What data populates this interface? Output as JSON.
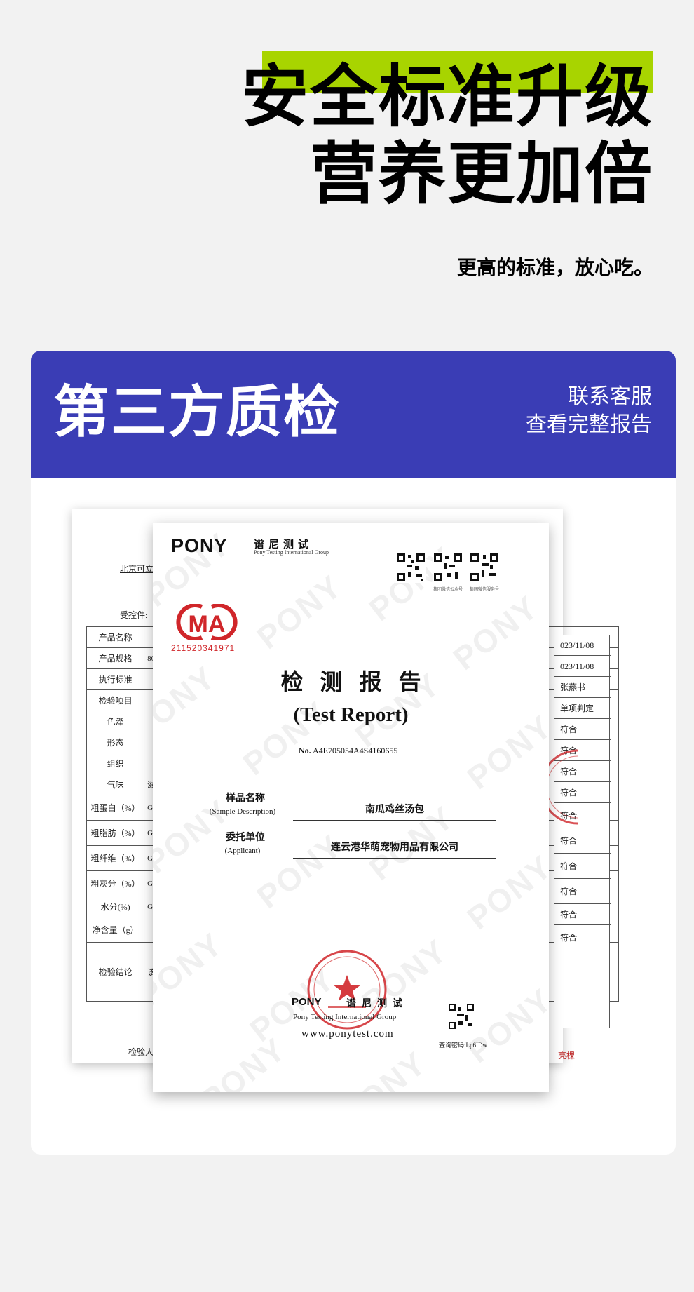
{
  "hero": {
    "line1": "安全标准升级",
    "line2": "营养更加倍",
    "subtitle": "更高的标准，放心吃。",
    "accent_color": "#a8d400"
  },
  "card": {
    "title": "第三方质检",
    "contact_line1": "联系客服",
    "contact_line2": "查看完整报告",
    "header_color": "#3a3db5"
  },
  "back_report": {
    "client": "北京可立",
    "ref_label": "受控件:",
    "rows": [
      {
        "label": "产品名称",
        "mid": "",
        "val": "023/11/08"
      },
      {
        "label": "产品规格",
        "mid": "80",
        "val": "023/11/08"
      },
      {
        "label": "执行标准",
        "mid": "",
        "val": "张燕书"
      },
      {
        "label": "检验项目",
        "mid": "",
        "val": "单项判定"
      },
      {
        "label": "色泽",
        "mid": "",
        "val": "符合"
      },
      {
        "label": "形态",
        "mid": "",
        "val": "符合"
      },
      {
        "label": "组织",
        "mid": "",
        "val": "符合"
      },
      {
        "label": "气味",
        "mid": "滋",
        "val": "符合"
      },
      {
        "label": "粗蛋白（%）",
        "mid": "Gl",
        "val": "符合"
      },
      {
        "label": "粗脂肪（%）",
        "mid": "Gl",
        "val": "符合"
      },
      {
        "label": "粗纤维（%）",
        "mid": "Gl",
        "val": "符合"
      },
      {
        "label": "粗灰分（%）",
        "mid": "Gl",
        "val": "符合"
      },
      {
        "label": "水分(%)",
        "mid": "Gl",
        "val": "符合"
      },
      {
        "label": "净含量（g）",
        "mid": "",
        "val": "符合"
      },
      {
        "label": "检验结论",
        "mid": "该产",
        "val": ""
      }
    ],
    "inspector": "检验人",
    "sign": "亮棵"
  },
  "front_report": {
    "brand": "PONY",
    "brand_cn": "谱尼测试",
    "brand_en": "Pony Testing International Group",
    "qr_captions": [
      "",
      "集团微信公众号",
      "集团微信服务号"
    ],
    "cma_text": "MA",
    "cma_number": "211520341971",
    "title_cn": "检测报告",
    "title_en": "(Test Report)",
    "no_label": "No.",
    "no_value": "A4E705054A4S4160655",
    "sample_label": "样品名称",
    "sample_sub": "(Sample Description)",
    "sample_value": "南瓜鸡丝汤包",
    "applicant_label": "委托单位",
    "applicant_sub": "(Applicant)",
    "applicant_value": "连云港华萌宠物用品有限公司",
    "bottom_brand": "PONY",
    "bottom_cn": "谱尼测试",
    "bottom_en": "Pony Testing International Group",
    "url": "www.ponytest.com",
    "password": "查询密码:Lp6IDw",
    "watermark": "PONY"
  }
}
